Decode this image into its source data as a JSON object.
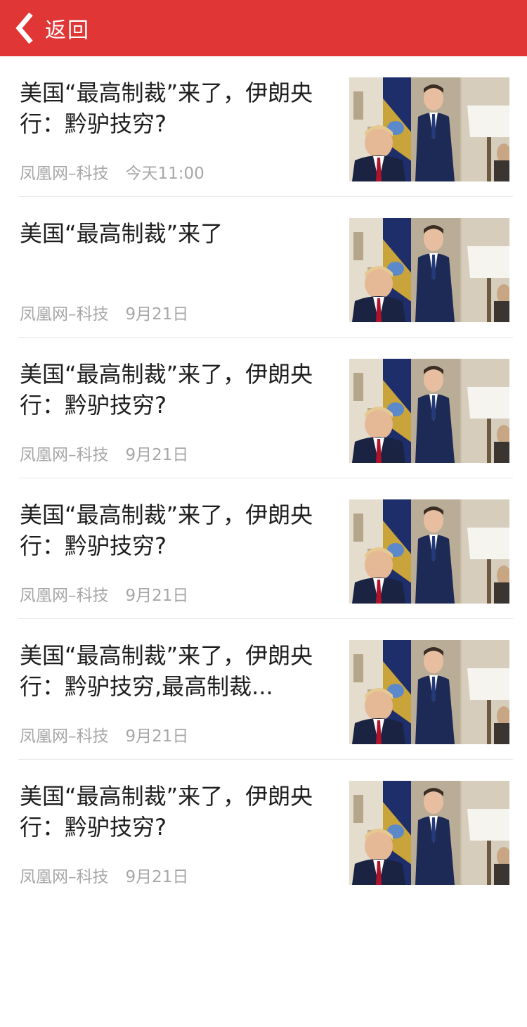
{
  "header": {
    "back_label": "返回",
    "bg_color": "#e03636",
    "back_icon": "chevron-left-icon"
  },
  "articles": [
    {
      "title": "美国“最高制裁”来了，伊朗央行：黔驴技穷?",
      "source": "凤凰网–科技",
      "time": "今天11:00"
    },
    {
      "title": "美国“最高制裁”来了",
      "source": "凤凰网–科技",
      "time": "9月21日"
    },
    {
      "title": "美国“最高制裁”来了，伊朗央行：黔驴技穷?",
      "source": "凤凰网–科技",
      "time": "9月21日"
    },
    {
      "title": "美国“最高制裁”来了，伊朗央行：黔驴技穷?",
      "source": "凤凰网–科技",
      "time": "9月21日"
    },
    {
      "title": "美国“最高制裁”来了，伊朗央行：黔驴技穷,最高制裁...",
      "source": "凤凰网–科技",
      "time": "9月21日"
    },
    {
      "title": "美国“最高制裁”来了，伊朗央行：黔驴技穷?",
      "source": "凤凰网–科技",
      "time": "9月21日"
    }
  ]
}
